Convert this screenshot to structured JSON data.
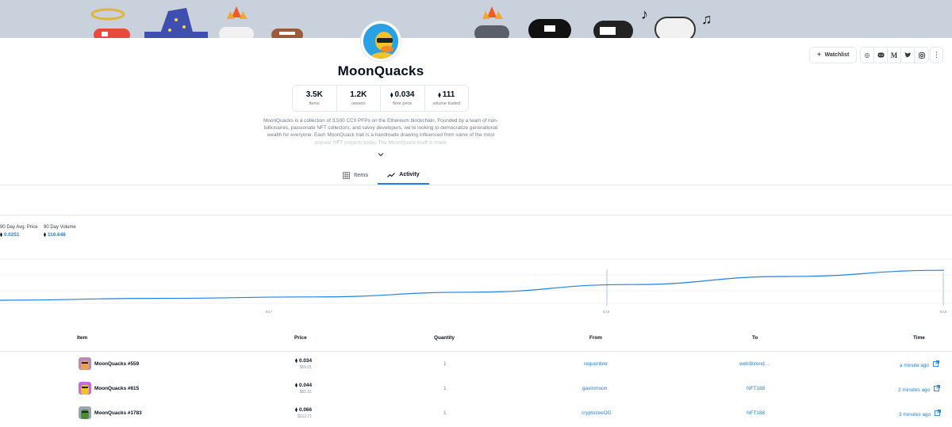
{
  "collection": {
    "name": "MoonQuacks",
    "description": "MoonQuacks is a collection of 3,500 CC0 PFPs on the Ethereum blockchain. Founded by a team of non-billionaires, passionate NFT collectors, and savvy developers, we're looking to democratize generational wealth for everyone. Each MoonQuack trait is a handmade drawing influenced from some of the most popular NFT projects today. The MoonQuack itself is made"
  },
  "stats": [
    {
      "value": "3.5K",
      "label": "items",
      "eth": false
    },
    {
      "value": "1.2K",
      "label": "owners",
      "eth": false
    },
    {
      "value": "0.034",
      "label": "floor price",
      "eth": true
    },
    {
      "value": "111",
      "label": "volume traded",
      "eth": true
    }
  ],
  "actions": {
    "watchlist_label": "Watchlist",
    "socials": [
      "globe-icon",
      "discord-icon",
      "medium-icon",
      "twitter-icon",
      "instagram-icon"
    ],
    "more": "more-icon"
  },
  "tabs": [
    {
      "label": "Items",
      "icon": "grid-icon",
      "active": false
    },
    {
      "label": "Activity",
      "icon": "activity-icon",
      "active": true
    }
  ],
  "kpis": {
    "avg_price_label": "90 Day Avg. Price",
    "avg_price_value": "0.0251",
    "volume_label": "90 Day Volume",
    "volume_value": "110.648"
  },
  "chart_data": {
    "type": "line",
    "x": [
      "6/17",
      "6/18",
      "6/19"
    ],
    "series": [
      {
        "values": [
          0.005,
          0.009,
          0.012,
          0.022,
          0.038,
          0.055,
          0.068
        ]
      }
    ],
    "accent": "#2081e2"
  },
  "table": {
    "headers": [
      "Item",
      "Price",
      "Quantity",
      "From",
      "To",
      "Time"
    ],
    "rows": [
      {
        "item": "MoonQuacks #559",
        "price": "0.034",
        "usd": "$59.01",
        "qty": "1",
        "from": "requonline",
        "to": "web3brend…",
        "time": "a minute ago"
      },
      {
        "item": "MoonQuacks #615",
        "price": "0.044",
        "usd": "$65.31",
        "qty": "1",
        "from": "gavinmoon",
        "to": "NFT188",
        "time": "2 minutes ago"
      },
      {
        "item": "MoonQuacks #1783",
        "price": "0.066",
        "usd": "$112.71",
        "qty": "1",
        "from": "cryptozeeOG",
        "to": "NFT188",
        "time": "3 minutes ago"
      }
    ]
  },
  "colors": {
    "accent": "#2081e2",
    "text": "#04111d",
    "muted": "#707a83",
    "border": "#e5e8eb"
  }
}
